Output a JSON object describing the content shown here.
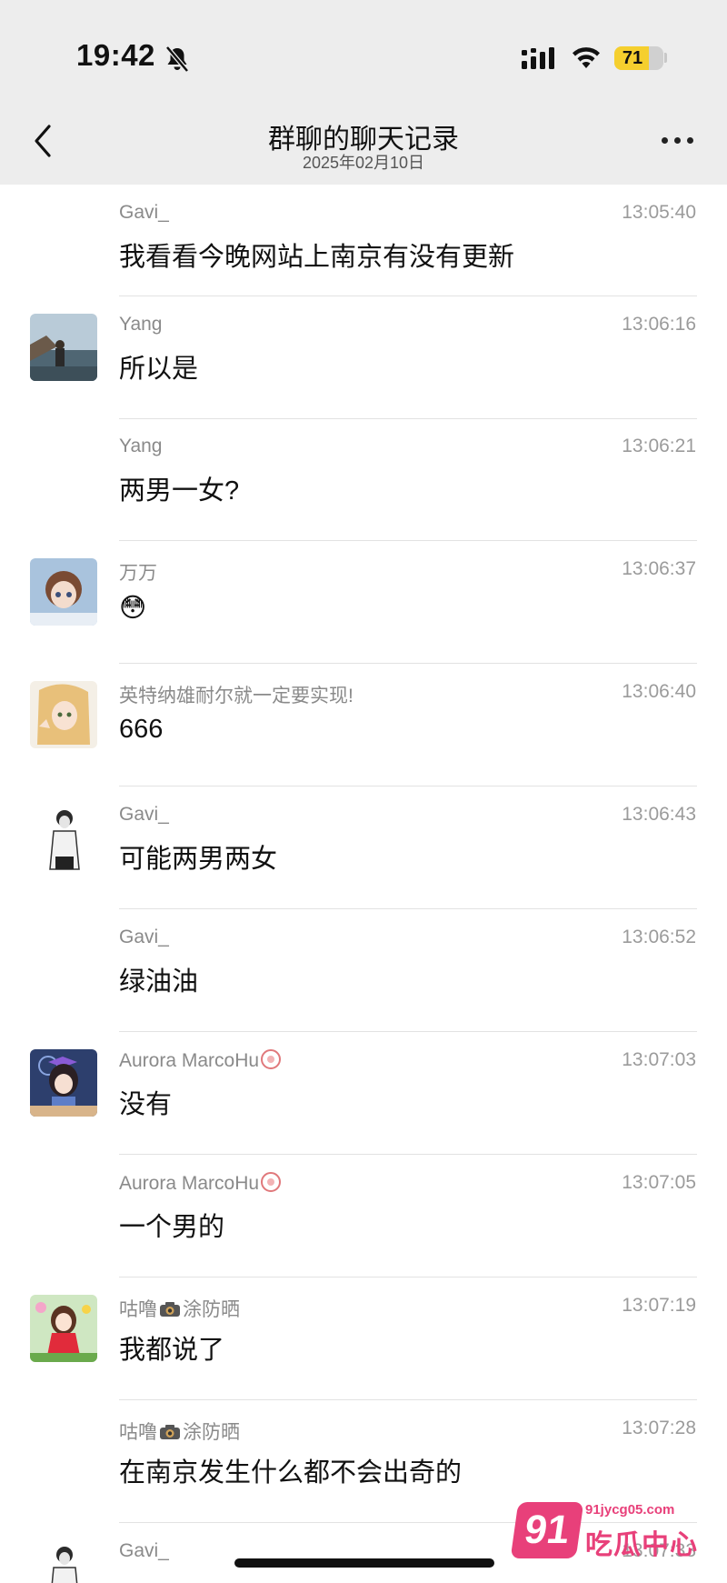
{
  "status_bar": {
    "time": "19:42",
    "battery": "71",
    "battery_level": 0.71
  },
  "header": {
    "title": "群聊的聊天记录",
    "subtitle": "2025年02月10日"
  },
  "messages": [
    {
      "sender": "Gavi_",
      "time": "13:05:40",
      "text": "我看看今晚网站上南京有没有更新",
      "avatar": ""
    },
    {
      "sender": "Yang",
      "time": "13:06:16",
      "text": "所以是",
      "avatar": "seaside-photo"
    },
    {
      "sender": "Yang",
      "time": "13:06:21",
      "text": "两男一女?",
      "avatar": ""
    },
    {
      "sender": "万万",
      "time": "13:06:37",
      "text": "😳",
      "avatar": "anime-girl-blue"
    },
    {
      "sender": "英特纳雄耐尔就一定要实现!",
      "time": "13:06:40",
      "text": "666",
      "avatar": "anime-girl-blonde"
    },
    {
      "sender": "Gavi_",
      "time": "13:06:43",
      "text": "可能两男两女",
      "avatar": "sketch-man"
    },
    {
      "sender": "Gavi_",
      "time": "13:06:52",
      "text": "绿油油",
      "avatar": ""
    },
    {
      "sender": "Aurora MarcoHu",
      "time": "13:07:03",
      "text": "没有",
      "avatar": "anime-girl-fireworks"
    },
    {
      "sender": "Aurora MarcoHu",
      "time": "13:07:05",
      "text": "一个男的",
      "avatar": ""
    },
    {
      "sender_a": "咕噜",
      "sender_b": "涂防晒",
      "time": "13:07:19",
      "text": "我都说了",
      "avatar": "cartoon-girl-red"
    },
    {
      "sender_a": "咕噜",
      "sender_b": "涂防晒",
      "time": "13:07:28",
      "text": "在南京发生什么都不会出奇的",
      "avatar": ""
    },
    {
      "sender": "Gavi_",
      "time": "13:07:33",
      "text": "",
      "avatar": "sketch-man"
    }
  ],
  "watermark": {
    "big": "91",
    "url": "91jycg05.com",
    "cn": "吃瓜中心"
  },
  "colors": {
    "header_bg": "#ededed",
    "battery_fill": "#f5cf2e",
    "watermark": "#e8407a"
  }
}
